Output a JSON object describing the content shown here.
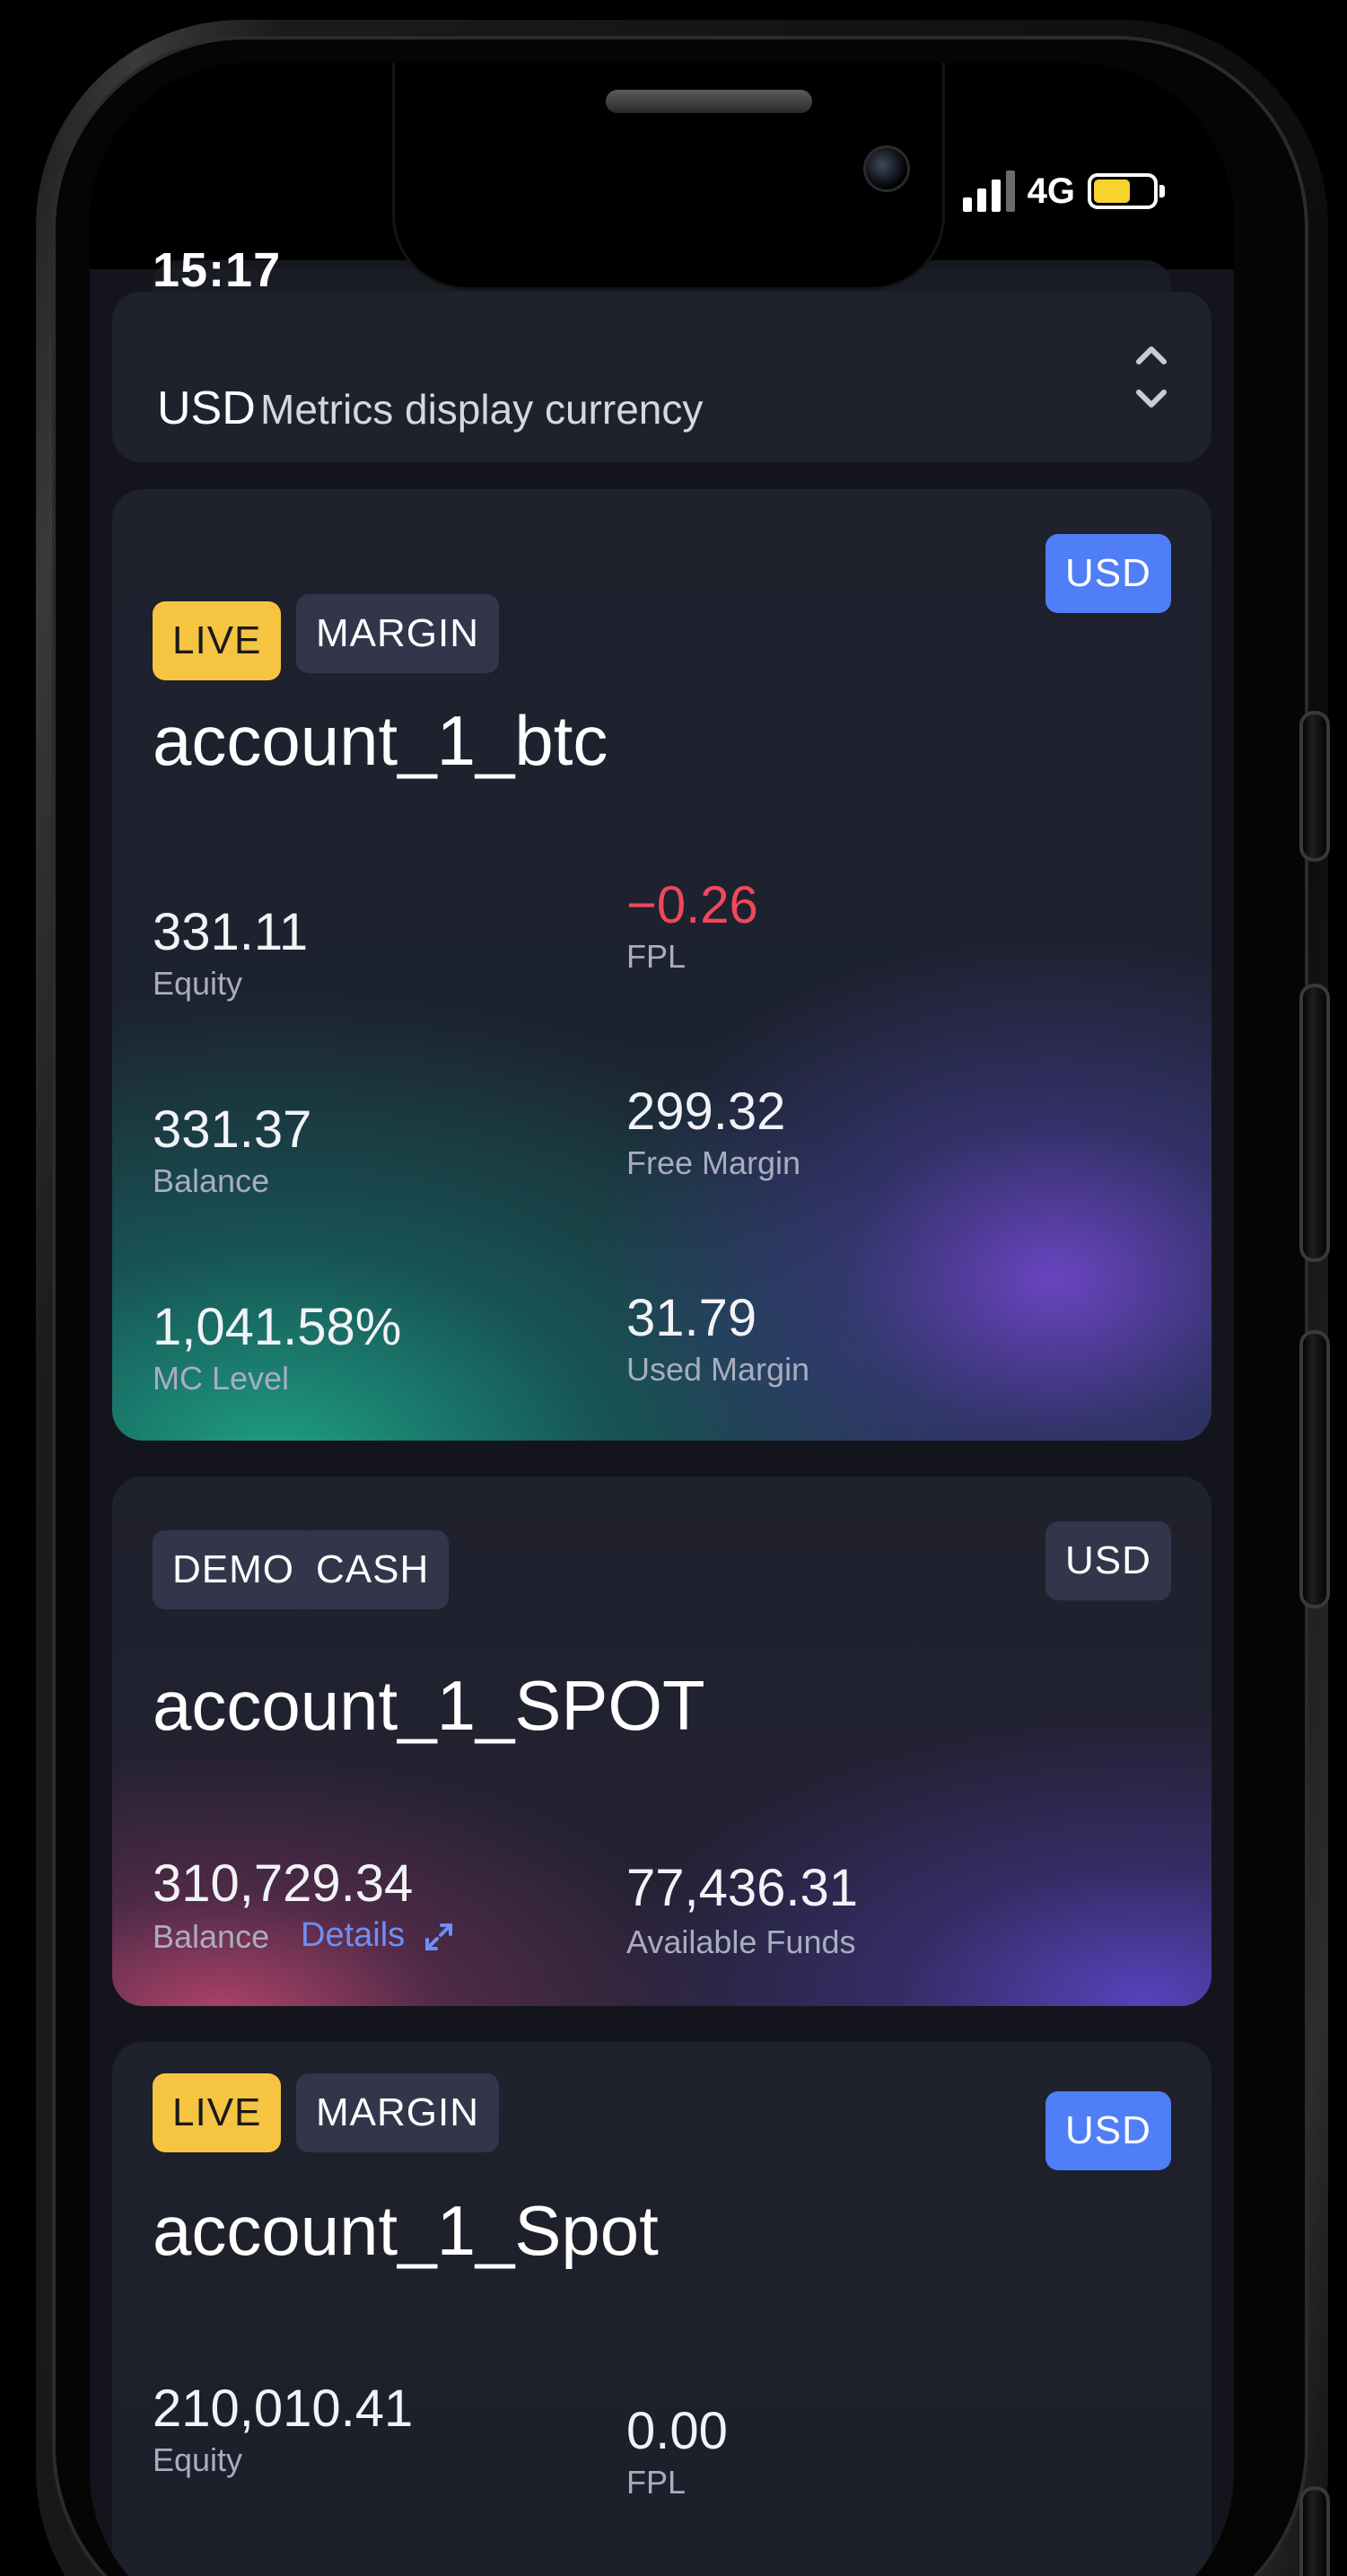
{
  "status_bar": {
    "time": "15:17",
    "network": "4G",
    "battery_color": "#f6d32d",
    "icons": [
      "signal-icon",
      "battery-icon"
    ]
  },
  "currency_selector": {
    "code": "USD",
    "label": "Metrics display currency",
    "icon": "chevron-up-down-icon"
  },
  "accounts": [
    {
      "badges": [
        "LIVE",
        "MARGIN"
      ],
      "currency": "USD",
      "name": "account_1_btc",
      "metrics": [
        {
          "value": "331.11",
          "label": "Equity"
        },
        {
          "value": "−0.26",
          "label": "FPL",
          "status": "negative"
        },
        {
          "value": "331.37",
          "label": "Balance"
        },
        {
          "value": "299.32",
          "label": "Free Margin"
        },
        {
          "value": "1,041.58%",
          "label": "MC Level"
        },
        {
          "value": "31.79",
          "label": "Used Margin"
        }
      ]
    },
    {
      "badges": [
        "DEMO",
        "CASH"
      ],
      "currency": "USD",
      "name": "account_1_SPOT",
      "metrics": [
        {
          "value": "310,729.34",
          "label": "Balance"
        },
        {
          "value": "77,436.31",
          "label": "Available Funds"
        }
      ],
      "details_link": "Details"
    },
    {
      "badges": [
        "LIVE",
        "MARGIN"
      ],
      "currency": "USD",
      "name": "account_1_Spot",
      "metrics": [
        {
          "value": "210,010.41",
          "label": "Equity"
        },
        {
          "value": "0.00",
          "label": "FPL"
        }
      ]
    }
  ],
  "colors": {
    "live_badge": "#f5c542",
    "usd_live_badge": "#4f7ef7",
    "negative": "#f0485b",
    "link": "#6f8ef7",
    "card_background": "#1f212c"
  }
}
